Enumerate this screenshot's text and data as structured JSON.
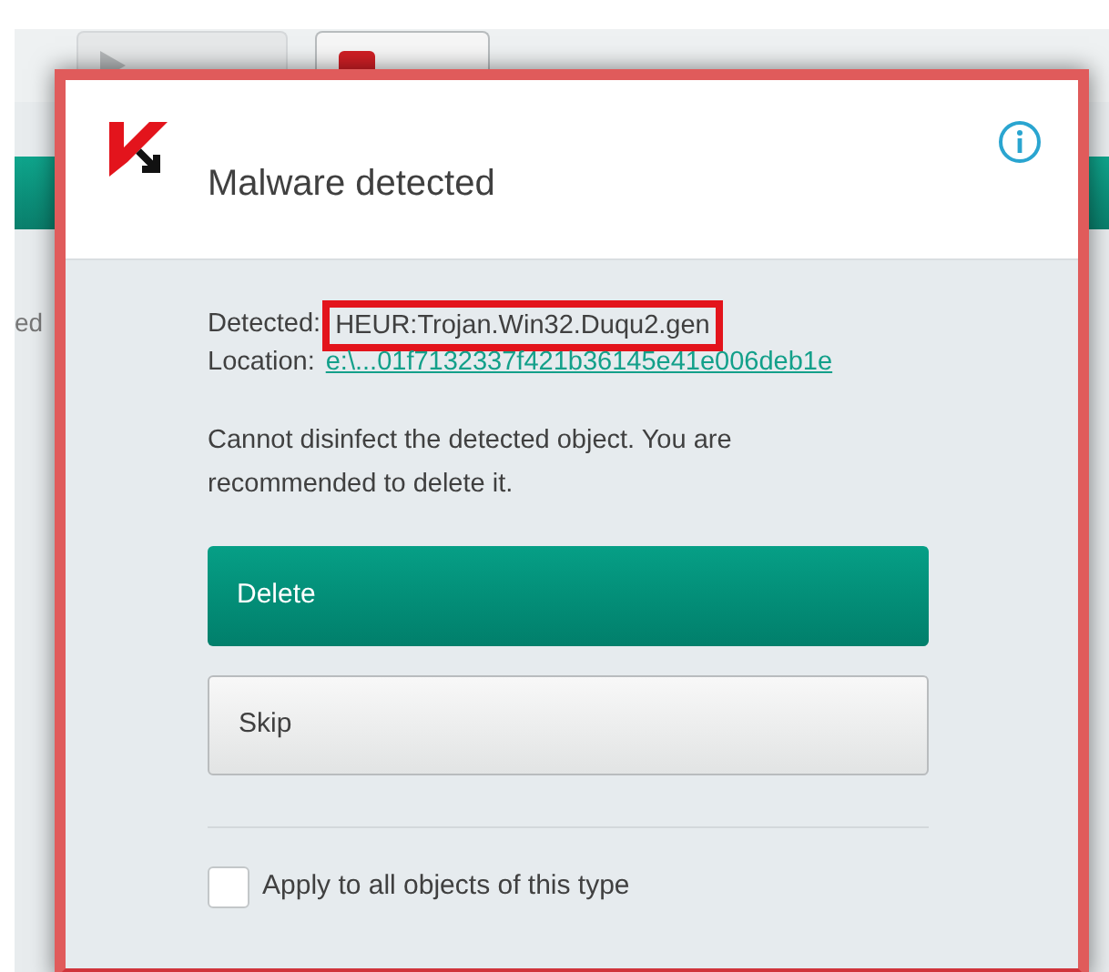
{
  "app": {
    "toolbar": [
      {
        "kind": "play",
        "disabled": true
      },
      {
        "kind": "stop",
        "disabled": false
      }
    ],
    "side_text": "ed"
  },
  "dialog": {
    "title": "Malware detected",
    "detected_label": "Detected:",
    "detected_value": "HEUR:Trojan.Win32.Duqu2.gen",
    "highlighted": true,
    "location_label": "Location:",
    "location_value": "e:\\...01f7132337f421b36145e41e006deb1e",
    "message": "Cannot disinfect the detected object. You are recommended to delete it.",
    "buttons": [
      {
        "label": "Delete",
        "kind": "primary"
      },
      {
        "label": "Skip",
        "kind": "secondary"
      }
    ],
    "checkbox": {
      "label": "Apply to all objects of this type",
      "checked": false
    }
  }
}
